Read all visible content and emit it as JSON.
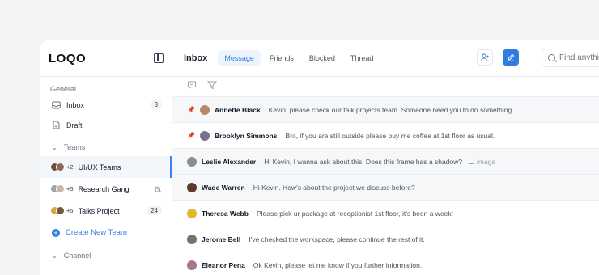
{
  "app": {
    "logo": "LOQO"
  },
  "sidebar": {
    "general_label": "General",
    "items": [
      {
        "label": "Inbox",
        "count": "3",
        "icon": "inbox-icon"
      },
      {
        "label": "Draft",
        "icon": "document-icon"
      }
    ],
    "teams_label": "Teams",
    "teams": [
      {
        "label": "UI/UX Teams",
        "extra": "+2",
        "active": true
      },
      {
        "label": "Research Gang",
        "extra": "+5",
        "muted": true
      },
      {
        "label": "Talks Project",
        "extra": "+5",
        "count": "24"
      }
    ],
    "create_team": "Create New Team",
    "channel_label": "Channel"
  },
  "header": {
    "title": "Inbox",
    "tabs": [
      {
        "label": "Message",
        "active": true
      },
      {
        "label": "Friends"
      },
      {
        "label": "Blocked"
      },
      {
        "label": "Thread"
      }
    ],
    "search_placeholder": "Find anything"
  },
  "messages": [
    {
      "name": "Annette Black",
      "text": "Kevin, please check our talk projects team. Someone need you to do something.",
      "pinned": true
    },
    {
      "name": "Brooklyn Simmons",
      "text": "Bro, if you are still outside please buy me coffee at 1st floor as usual.",
      "pinned": true
    },
    {
      "name": "Leslie Alexander",
      "text": "Hi Kevin, I wanna ask about this. Does this frame has a shadow?",
      "attachment": "image"
    },
    {
      "name": "Wade Warren",
      "text": "Hi Kevin. How's about the project we discuss before?"
    },
    {
      "name": "Theresa Webb",
      "text": "Please pick ur package at receptionist 1st floor, it's been a week!"
    },
    {
      "name": "Jerome Bell",
      "text": "I've checked the workspace, please continue the rest of it."
    },
    {
      "name": "Eleanor Pena",
      "text": "Ok Kevin, please let me know if you further information."
    }
  ],
  "colors": {
    "accent": "#2f7de1",
    "pin": "#e11d48"
  }
}
